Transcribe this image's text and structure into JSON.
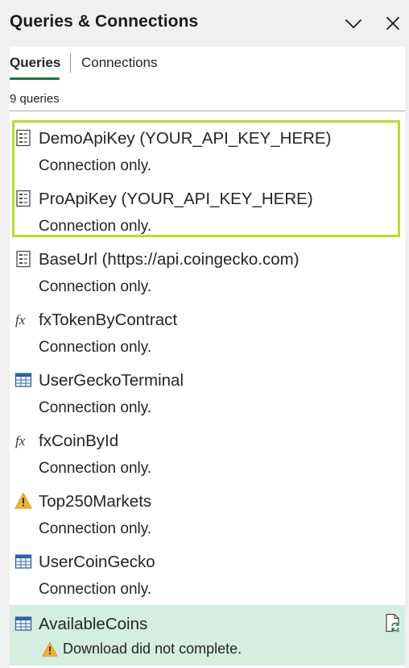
{
  "pane": {
    "title": "Queries & Connections",
    "collapse_icon": "chevron-down-icon",
    "close_icon": "close-icon"
  },
  "tabs": [
    {
      "label": "Queries",
      "active": true
    },
    {
      "label": "Connections",
      "active": false
    }
  ],
  "count_label": "9 queries",
  "queries": [
    {
      "name": "DemoApiKey (YOUR_API_KEY_HERE)",
      "status": "Connection only.",
      "icon": "parameter-icon",
      "highlighted": true
    },
    {
      "name": "ProApiKey (YOUR_API_KEY_HERE)",
      "status": "Connection only.",
      "icon": "parameter-icon",
      "highlighted": true
    },
    {
      "name": "BaseUrl (https://api.coingecko.com)",
      "status": "Connection only.",
      "icon": "parameter-icon"
    },
    {
      "name": "fxTokenByContract",
      "status": "Connection only.",
      "icon": "function-icon"
    },
    {
      "name": "UserGeckoTerminal",
      "status": "Connection only.",
      "icon": "table-icon"
    },
    {
      "name": "fxCoinById",
      "status": "Connection only.",
      "icon": "function-icon"
    },
    {
      "name": "Top250Markets",
      "status": "Connection only.",
      "icon": "warning-icon"
    },
    {
      "name": "UserCoinGecko",
      "status": "Connection only.",
      "icon": "table-icon"
    },
    {
      "name": "AvailableCoins",
      "status": "Download did not complete.",
      "icon": "table-icon",
      "selected": true,
      "status_icon": "warning-icon",
      "action_icon": "refresh-icon"
    }
  ],
  "colors": {
    "highlight_border": "#b4df25",
    "selected_bg": "#d4eee0",
    "tab_underline": "#1e7145",
    "table_icon": "#2b62a8",
    "warning": "#f2b233"
  }
}
